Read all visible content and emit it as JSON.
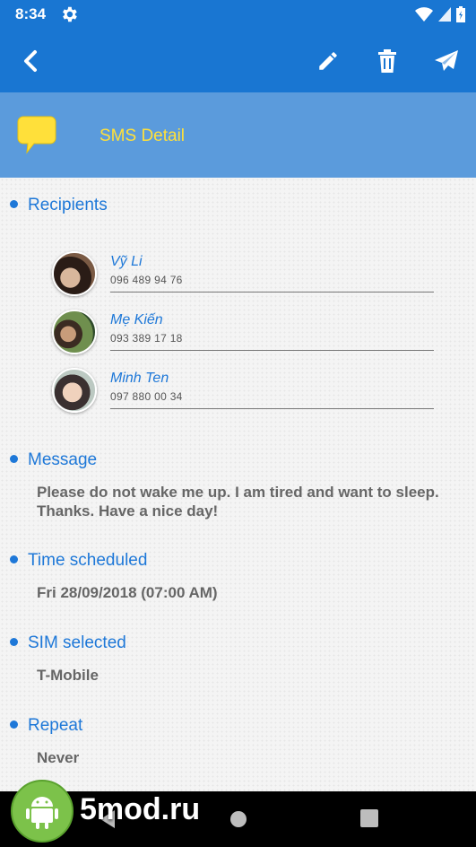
{
  "status": {
    "time": "8:34"
  },
  "header": {
    "title": "SMS Detail"
  },
  "sections": {
    "recipients_label": "Recipients",
    "message_label": "Message",
    "message_value": "Please do not wake me up. I am tired and want to sleep. Thanks. Have a nice day!",
    "time_label": "Time scheduled",
    "time_value": "Fri 28/09/2018 (07:00 AM)",
    "sim_label": "SIM selected",
    "sim_value": "T-Mobile",
    "repeat_label": "Repeat",
    "repeat_value": "Never"
  },
  "recipients": [
    {
      "name": "Vỹ Li",
      "phone": "096 489 94 76"
    },
    {
      "name": "Mẹ Kiến",
      "phone": "093 389 17 18"
    },
    {
      "name": "Minh Ten",
      "phone": "097 880 00 34"
    }
  ],
  "watermark": {
    "text": "5mod.ru"
  },
  "colors": {
    "primary": "#1976d2",
    "header_band": "#5b9bdc",
    "accent_title": "#ffe03a",
    "label_blue": "#1e78d8"
  }
}
